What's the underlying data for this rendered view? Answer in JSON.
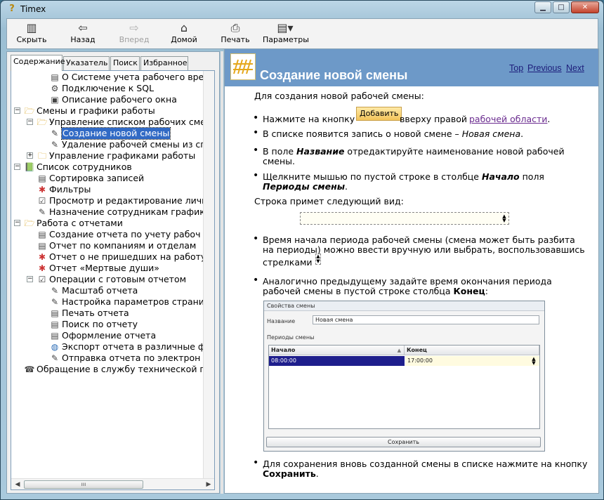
{
  "window": {
    "title": "Timex",
    "app_icon": "help-question-icon",
    "minimize": "minimize-icon",
    "maximize": "maximize-icon",
    "close": "close-icon"
  },
  "toolbar": {
    "buttons": [
      {
        "label": "Скрыть",
        "icon": "hide-pane-icon",
        "enabled": true
      },
      {
        "label": "Назад",
        "icon": "back-arrow-icon",
        "enabled": true
      },
      {
        "label": "Вперед",
        "icon": "forward-arrow-icon",
        "enabled": false
      },
      {
        "label": "Домой",
        "icon": "home-icon",
        "enabled": true
      },
      {
        "label": "Печать",
        "icon": "printer-icon",
        "enabled": true
      },
      {
        "label": "Параметры",
        "icon": "options-icon",
        "enabled": true
      }
    ]
  },
  "nav_tabs": [
    {
      "label": "Содержание",
      "active": true
    },
    {
      "label": "Указатель",
      "active": false
    },
    {
      "label": "Поиск",
      "active": false
    },
    {
      "label": "Избранное",
      "active": false
    }
  ],
  "tree": [
    {
      "label": "О Системе учета рабочего времени",
      "icon": "topic-page-icon",
      "selected": false
    },
    {
      "label": "Подключение к SQL",
      "icon": "topic-connect-icon",
      "selected": false
    },
    {
      "label": "Описание рабочего окна",
      "icon": "topic-window-icon",
      "selected": false
    },
    {
      "label": "Смены и графики работы",
      "icon": "folder-open-icon",
      "expander": "−",
      "selected": false
    },
    {
      "label": "Управление списком рабочих сме",
      "icon": "folder-open-icon",
      "expander": "−",
      "selected": false
    },
    {
      "label": "Создание новой смены",
      "icon": "topic-edit-icon",
      "selected": true
    },
    {
      "label": "Удаление рабочей смены из сп",
      "icon": "topic-edit-icon",
      "selected": false
    },
    {
      "label": "Управление графиками работы",
      "icon": "folder-closed-icon",
      "expander": "+",
      "selected": false
    },
    {
      "label": "Список сотрудников",
      "icon": "book-icon",
      "expander": "−",
      "selected": false
    },
    {
      "label": "Сортировка записей",
      "icon": "topic-page-icon",
      "selected": false
    },
    {
      "label": "Фильтры",
      "icon": "topic-filter-icon",
      "selected": false
    },
    {
      "label": "Просмотр и редактирование личн",
      "icon": "topic-check-icon",
      "selected": false
    },
    {
      "label": "Назначение сотрудникам график",
      "icon": "topic-edit-icon",
      "selected": false
    },
    {
      "label": "Работа с отчетами",
      "icon": "folder-open-icon",
      "expander": "−",
      "selected": false
    },
    {
      "label": "Создание отчета по учету рабоч",
      "icon": "topic-page-icon",
      "selected": false
    },
    {
      "label": "Отчет по компаниям и отделам",
      "icon": "topic-page-icon",
      "selected": false
    },
    {
      "label": "Отчет о не пришедших на работу",
      "icon": "topic-filter-icon",
      "selected": false
    },
    {
      "label": "Отчет «Мертвые души»",
      "icon": "topic-filter-icon",
      "selected": false
    },
    {
      "label": "Операции с готовым отчетом",
      "icon": "topic-check-icon",
      "expander": "−",
      "selected": false
    },
    {
      "label": "Масштаб отчета",
      "icon": "topic-edit-icon",
      "selected": false
    },
    {
      "label": "Настройка параметров страни",
      "icon": "topic-edit-icon",
      "selected": false
    },
    {
      "label": "Печать отчета",
      "icon": "topic-page-icon",
      "selected": false
    },
    {
      "label": "Поиск по отчету",
      "icon": "topic-page-icon",
      "selected": false
    },
    {
      "label": "Оформление отчета",
      "icon": "topic-page-icon",
      "selected": false
    },
    {
      "label": "Экспорт отчета в различные ф",
      "icon": "topic-globe-icon",
      "selected": false
    },
    {
      "label": "Отправка отчета по электрон",
      "icon": "topic-edit-icon",
      "selected": false
    },
    {
      "label": "Обращение в службу технической п",
      "icon": "topic-support-icon",
      "selected": false
    }
  ],
  "tree_scroll_thumb": "ııı",
  "topic": {
    "title": "Создание новой смены",
    "nav": {
      "top": "Top",
      "previous": "Previous",
      "next": "Next"
    },
    "intro": "Для создания новой рабочей смены:",
    "b1_pre": "Нажмите на кнопку",
    "b1_button": "Добавить",
    "b1_mid": "вверху правой",
    "b1_link": "рабочей области",
    "b1_end": ".",
    "b2_pre": "В списке появится запись о новой смене –",
    "b2_em": "Новая смена",
    "b2_end": ".",
    "b3_pre": "В поле",
    "b3_strong": "Название",
    "b3_post": "отредактируйте наименование новой рабочей",
    "b3_line2": "смены.",
    "b4_pre": "Щелкните мышью по пустой строке в столбце",
    "b4_strong": "Начало",
    "b4_post": "поля",
    "b4_line2_strong": "Периоды смены",
    "b4_line2_end": ".",
    "row_line": "Строка примет следующий вид:",
    "b5_line1": "Время начала периода рабочей смены (смена может быть разбита",
    "b5_line2": "на периоды) можно ввести вручную или выбрать, воспользовавшись",
    "b5_line3": "стрелками",
    "b6_line1": "Аналогично предыдущему задайте время окончания периода",
    "b6_line2_pre": "рабочей смены в пустой строке столбца",
    "b6_line2_strong": "Конец",
    "b6_line2_end": ":",
    "b7_line1": "Для сохранения вновь созданной смены в списке нажмите на кнопку",
    "b7_line2_strong": "Сохранить",
    "b7_line2_end": "."
  },
  "screenshot": {
    "title": "Свойства смены",
    "name_label": "Название",
    "name_value": "Новая смена",
    "periods_label": "Периоды смены",
    "col_start": "Начало",
    "col_end": "Конец",
    "row_start": "08:00:00",
    "row_end": "17:00:00",
    "save": "Сохранить"
  },
  "colors": {
    "header_bg": "#6d99c8",
    "selection": "#316ac5",
    "link_visited": "#6a2b8f"
  }
}
